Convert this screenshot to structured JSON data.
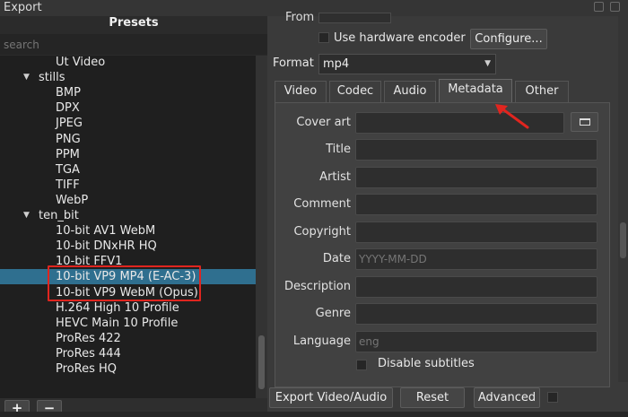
{
  "window": {
    "title": "Export"
  },
  "presets": {
    "header": "Presets",
    "search_placeholder": "search",
    "items": [
      {
        "label": "Ut Video",
        "kind": "item",
        "selected": false
      },
      {
        "label": "stills",
        "kind": "group",
        "selected": false
      },
      {
        "label": "BMP",
        "kind": "item",
        "selected": false
      },
      {
        "label": "DPX",
        "kind": "item",
        "selected": false
      },
      {
        "label": "JPEG",
        "kind": "item",
        "selected": false
      },
      {
        "label": "PNG",
        "kind": "item",
        "selected": false
      },
      {
        "label": "PPM",
        "kind": "item",
        "selected": false
      },
      {
        "label": "TGA",
        "kind": "item",
        "selected": false
      },
      {
        "label": "TIFF",
        "kind": "item",
        "selected": false
      },
      {
        "label": "WebP",
        "kind": "item",
        "selected": false
      },
      {
        "label": "ten_bit",
        "kind": "group",
        "selected": false
      },
      {
        "label": "10-bit AV1 WebM",
        "kind": "item",
        "selected": false
      },
      {
        "label": "10-bit DNxHR HQ",
        "kind": "item",
        "selected": false
      },
      {
        "label": "10-bit FFV1",
        "kind": "item",
        "selected": false
      },
      {
        "label": "10-bit VP9 MP4 (E-AC-3)",
        "kind": "item",
        "selected": true
      },
      {
        "label": "10-bit VP9 WebM (Opus)",
        "kind": "item",
        "selected": false
      },
      {
        "label": "H.264 High 10 Profile",
        "kind": "item",
        "selected": false
      },
      {
        "label": "HEVC Main 10 Profile",
        "kind": "item",
        "selected": false
      },
      {
        "label": "ProRes 422",
        "kind": "item",
        "selected": false
      },
      {
        "label": "ProRes 444",
        "kind": "item",
        "selected": false
      },
      {
        "label": "ProRes HQ",
        "kind": "item",
        "selected": false
      }
    ],
    "add_label": "+",
    "remove_label": "−"
  },
  "top": {
    "from_label": "From",
    "hw_encoder_label": "Use hardware encoder",
    "hw_encoder_checked": false,
    "configure_label": "Configure..."
  },
  "format": {
    "label": "Format",
    "value": "mp4"
  },
  "tabs": [
    {
      "label": "Video",
      "active": false
    },
    {
      "label": "Codec",
      "active": false
    },
    {
      "label": "Audio",
      "active": false
    },
    {
      "label": "Metadata",
      "active": true
    },
    {
      "label": "Other",
      "active": false
    }
  ],
  "metadata": {
    "fields": [
      {
        "label": "Cover art",
        "value": "",
        "placeholder": ""
      },
      {
        "label": "Title",
        "value": "",
        "placeholder": ""
      },
      {
        "label": "Artist",
        "value": "",
        "placeholder": ""
      },
      {
        "label": "Comment",
        "value": "",
        "placeholder": ""
      },
      {
        "label": "Copyright",
        "value": "",
        "placeholder": ""
      },
      {
        "label": "Date",
        "value": "",
        "placeholder": "YYYY-MM-DD"
      },
      {
        "label": "Description",
        "value": "",
        "placeholder": ""
      },
      {
        "label": "Genre",
        "value": "",
        "placeholder": ""
      },
      {
        "label": "Language",
        "value": "",
        "placeholder": "eng"
      }
    ],
    "disable_subtitles_label": "Disable subtitles",
    "disable_subtitles_checked": false
  },
  "actions": {
    "export_label": "Export Video/Audio",
    "reset_label": "Reset",
    "advanced_label": "Advanced",
    "advanced_checked": false
  },
  "colors": {
    "selection": "#2f6f8f",
    "annotation_red": "#e0251f"
  }
}
